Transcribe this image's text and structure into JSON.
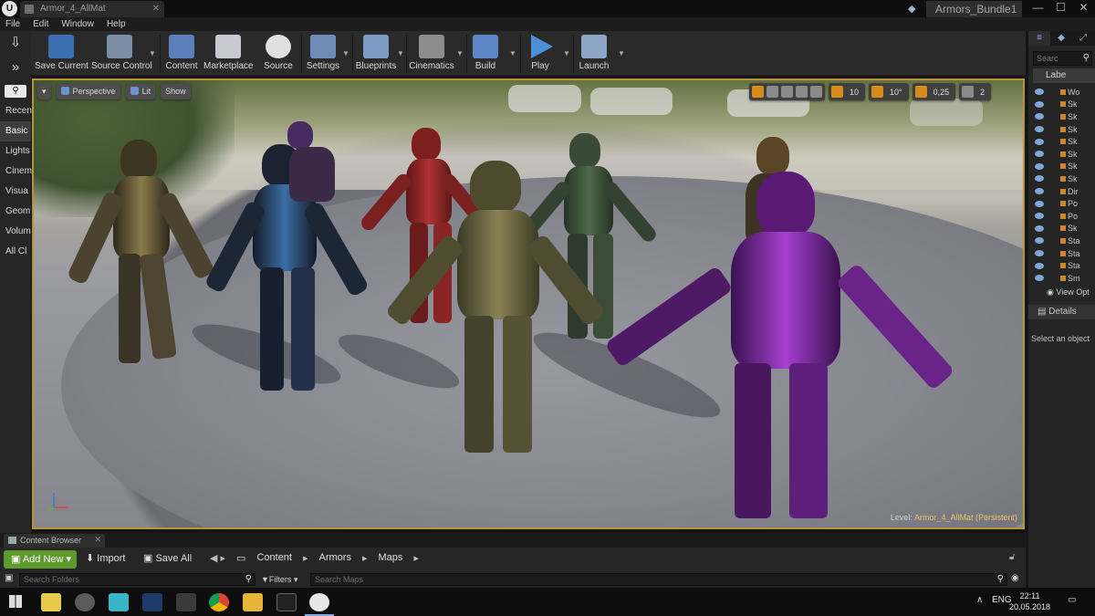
{
  "window": {
    "doc_tab": "Armor_4_AllMat",
    "project_name": "Armors_Bundle1",
    "controls": [
      "—",
      "☐",
      "✕"
    ]
  },
  "menu": [
    "File",
    "Edit",
    "Window",
    "Help"
  ],
  "left_strip": {
    "tools": [
      "⇩",
      "»"
    ],
    "categories": [
      "Recen",
      "Basic",
      "Lights",
      "Cinem",
      "Visua",
      "Geom",
      "Volum",
      "All Cl"
    ]
  },
  "toolbar": {
    "buttons": [
      {
        "label": "Save Current",
        "icon": "save-icon",
        "color": "#3a6fb0"
      },
      {
        "label": "Source Control",
        "icon": "source-control-icon",
        "color": "#7b8ea6"
      },
      {
        "label": "Content",
        "icon": "content-icon",
        "color": "#5b7fb8"
      },
      {
        "label": "Marketplace",
        "icon": "marketplace-icon",
        "color": "#c9c9d1"
      },
      {
        "label": "Source",
        "icon": "source-icon",
        "color": "#e0e0e0"
      },
      {
        "label": "Settings",
        "icon": "settings-icon",
        "color": "#6e8bb8"
      },
      {
        "label": "Blueprints",
        "icon": "blueprints-icon",
        "color": "#7d9ac4"
      },
      {
        "label": "Cinematics",
        "icon": "cinematics-icon",
        "color": "#8c8c8c"
      },
      {
        "label": "Build",
        "icon": "build-icon",
        "color": "#5c86c6"
      },
      {
        "label": "Play",
        "icon": "play-icon",
        "color": "#4f8fd6"
      },
      {
        "label": "Launch",
        "icon": "launch-icon",
        "color": "#8da6c8"
      }
    ]
  },
  "viewport": {
    "perspective": "Perspective",
    "lit": "Lit",
    "show": "Show",
    "grid_snap": "10",
    "rot_snap": "10°",
    "scale_snap": "0,25",
    "cam_speed": "2",
    "level_label": "Level:",
    "level_name": "Armor_4_AllMat (Persistent)"
  },
  "outliner": {
    "search_placeholder": "Searc",
    "label_header": "Labe",
    "rows": [
      "Wo",
      "Sk",
      "Sk",
      "Sk",
      "Sk",
      "Sk",
      "Sk",
      "Sk",
      "Dir",
      "Po",
      "Po",
      "Sk",
      "Sta",
      "Sta",
      "Sta",
      "Sm"
    ],
    "view_options": "View Opt"
  },
  "details": {
    "tab": "Details",
    "empty": "Select an object"
  },
  "content_browser": {
    "tab": "Content Browser",
    "add_new": "Add New",
    "import": "Import",
    "save_all": "Save All",
    "path": [
      "Content",
      "Armors",
      "Maps"
    ],
    "search_folders": "Search Folders",
    "filters": "Filters",
    "search_maps": "Search Maps"
  },
  "taskbar": {
    "language": "ENG",
    "time": "22:11",
    "date": "20.05.2018"
  }
}
